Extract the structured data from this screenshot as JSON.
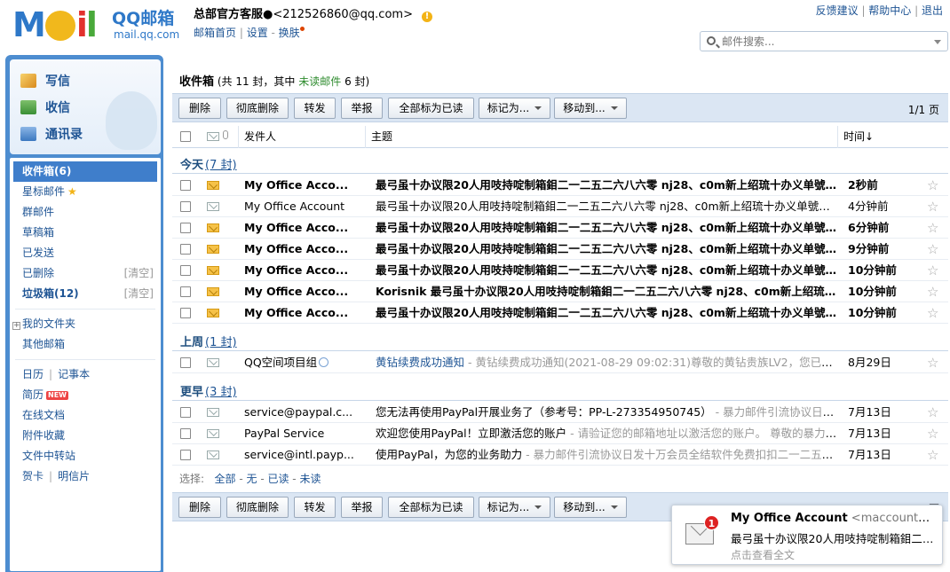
{
  "header": {
    "brand": "QQ邮箱",
    "domain": "mail.qq.com",
    "account_name": "总部官方客服●",
    "account_email": "<212526860@qq.com>",
    "links": {
      "home": "邮箱首页",
      "settings": "设置",
      "skin": "换肤"
    },
    "top_links": [
      "反馈建议",
      "帮助中心",
      "退出"
    ],
    "search_placeholder": "邮件搜索..."
  },
  "quick_actions": [
    {
      "label": "写信",
      "icon": "compose-icon"
    },
    {
      "label": "收信",
      "icon": "inbox-download-icon"
    },
    {
      "label": "通讯录",
      "icon": "contacts-icon"
    }
  ],
  "folders": {
    "inbox": "收件箱(6)",
    "starred": "星标邮件",
    "group": "群邮件",
    "drafts": "草稿箱",
    "sent": "已发送",
    "deleted": "已删除",
    "spam": "垃圾箱(12)",
    "clear": "[清空]",
    "my_folders": "我的文件夹",
    "other_mail": "其他邮箱",
    "calendar": "日历",
    "notes": "记事本",
    "resume": "简历",
    "new_badge": "NEW",
    "docs": "在线文档",
    "attachments": "附件收藏",
    "transfer": "文件中转站",
    "cards": "贺卡",
    "postcard": "明信片"
  },
  "main": {
    "title": "收件箱",
    "summary_prefix": " (共 11 封，其中 ",
    "unread_label": "未读邮件",
    "summary_suffix": " 6 封)",
    "buttons": [
      "删除",
      "彻底删除",
      "转发",
      "举报",
      "全部标为已读",
      "标记为...",
      "移动到..."
    ],
    "pager": "1/1 页",
    "columns": {
      "from": "发件人",
      "subject": "主题",
      "time": "时间↓"
    },
    "groups": [
      {
        "label": "今天",
        "count": "(7 封)"
      },
      {
        "label": "上周",
        "count": "(1 封)"
      },
      {
        "label": "更早",
        "count": "(3 封)"
      }
    ],
    "emails": [
      {
        "from": "My Office Acco...",
        "subject": "最弓虽十办议限20人用吱持啶制箱鉬二一二五二六八六零 nj28、c0m新上绍琉十办义单號日...",
        "preview": "",
        "time": "2秒前"
      },
      {
        "from": "My Office Account",
        "subject": "最弓虽十办议限20人用吱持啶制箱鉬二一二五二六八六零 nj28、c0m新上绍琉十办义单號日发...",
        "preview": "",
        "time": "4分钟前"
      },
      {
        "from": "My Office Acco...",
        "subject": "最弓虽十办议限20人用吱持啶制箱鉬二一二五二六八六零 nj28、c0m新上绍琉十办义单號日...",
        "preview": "",
        "time": "6分钟前"
      },
      {
        "from": "My Office Acco...",
        "subject": "最弓虽十办议限20人用吱持啶制箱鉬二一二五二六八六零 nj28、c0m新上绍琉十办义单號日...",
        "preview": "",
        "time": "9分钟前"
      },
      {
        "from": "My Office Acco...",
        "subject": "最弓虽十办议限20人用吱持啶制箱鉬二一二五二六八六零 nj28、c0m新上绍琉十办义单號日...",
        "preview": "",
        "time": "10分钟前"
      },
      {
        "from": "My Office Acco...",
        "subject": "Korisnik 最弓虽十办议限20人用吱持啶制箱鉬二一二五二六八六零 nj28、c0m新上绍琉十...",
        "preview": "",
        "time": "10分钟前"
      },
      {
        "from": "My Office Acco...",
        "subject": "最弓虽十办议限20人用吱持啶制箱鉬二一二五二六八六零 nj28、c0m新上绍琉十办义单號日...",
        "preview": "",
        "time": "10分钟前"
      },
      {
        "from": "QQ空间项目组",
        "subject": "黄钻续费成功通知",
        "preview": " - 黄钻续费成功通知(2021-08-29 09:02:31)尊敬的黄钻贵族LV2，您已续...",
        "time": "8月29日"
      },
      {
        "from": "service@paypal.c...",
        "subject": "您无法再使用PayPal开展业务了（参考号：PP-L-273354950745）",
        "preview": " - 暴力邮件引流协议日发...",
        "time": "7月13日"
      },
      {
        "from": "PayPal Service",
        "subject": "欢迎您使用PayPal！立即激活您的账户",
        "preview": " - 请验证您的邮箱地址以激活您的账户。 尊敬的暴力邮...",
        "time": "7月13日"
      },
      {
        "from": "service@intl.payp...",
        "subject": "使用PayPal，为您的业务助力",
        "preview": " - 暴力邮件引流协议日发十万会员全结软件免费扣扣二一二五二...",
        "time": "7月13日"
      }
    ],
    "select_bar": {
      "label": "选择:",
      "all": "全部",
      "none": "无",
      "read": "已读",
      "unread": "未读"
    }
  },
  "notification": {
    "count": "1",
    "sender": "My Office Account",
    "address": " <maccount@m...",
    "body": "最弓虽十办议限20人用吱持啶制箱鉬二一...",
    "more": "点击查看全文"
  },
  "colors": {
    "accent": "#3f7ecb",
    "frame": "#4d8dd0",
    "toolbar": "#dbe6f3",
    "unread_green": "#2d8b2d"
  }
}
